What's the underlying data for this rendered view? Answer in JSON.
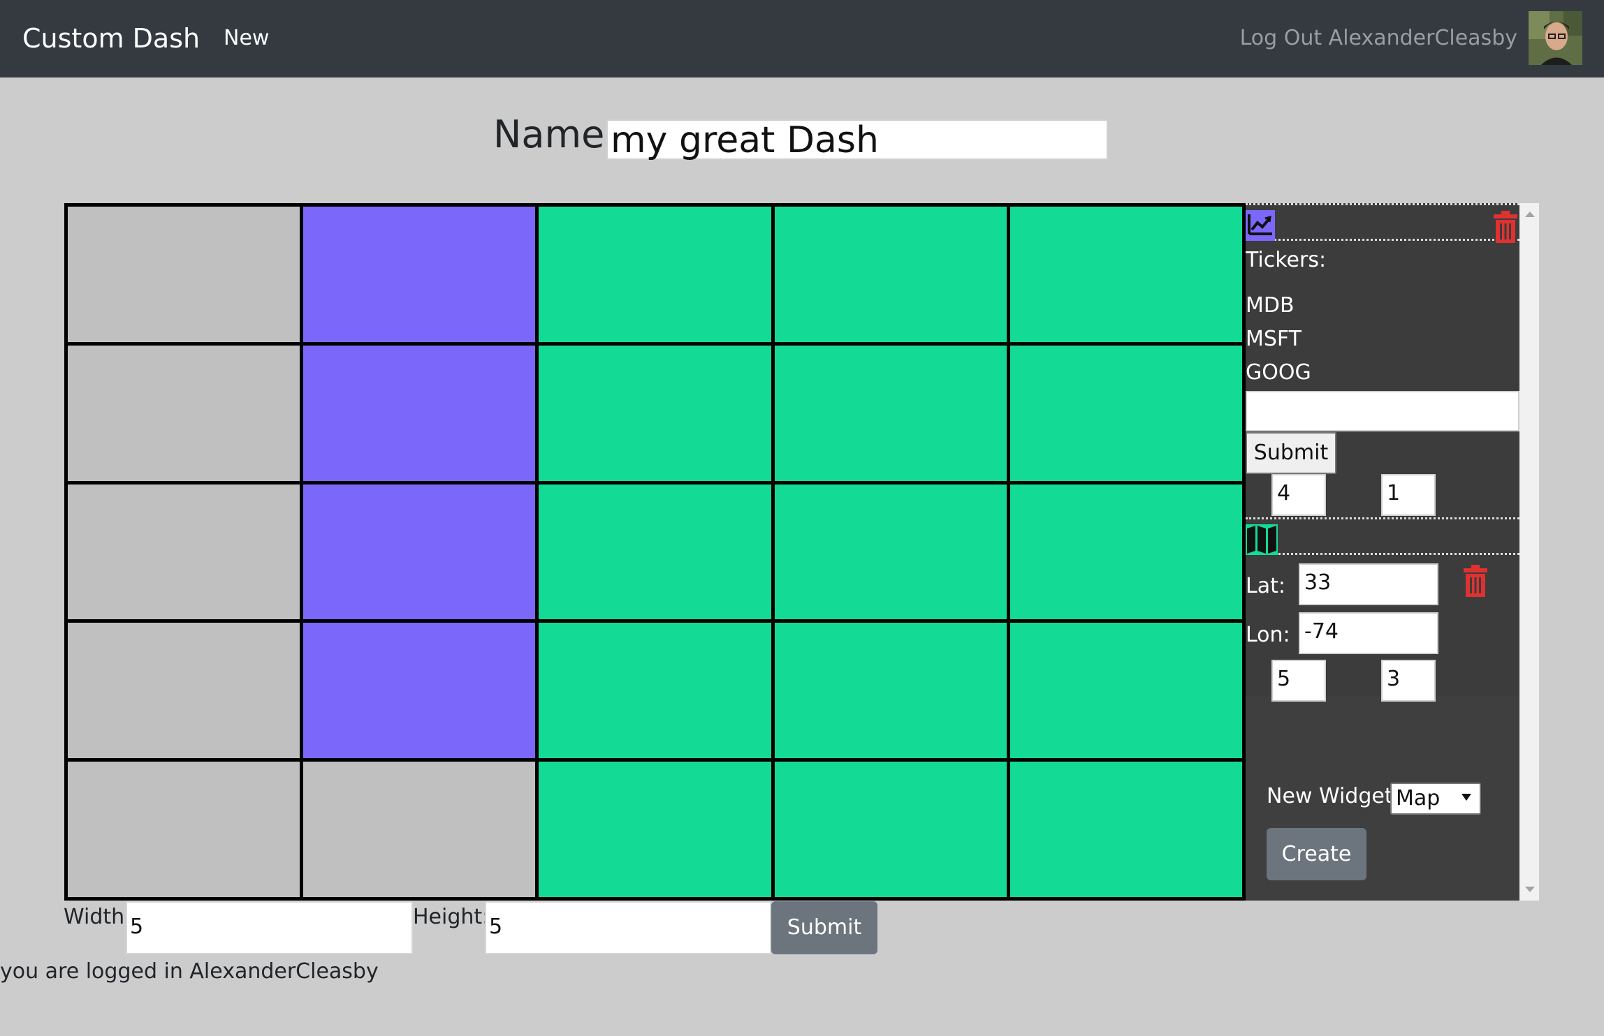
{
  "navbar": {
    "brand": "Custom Dash",
    "new_link": "New",
    "logout": "Log Out AlexanderCleasby"
  },
  "name_field": {
    "label": "Name:",
    "value": "my great Dash"
  },
  "grid": {
    "rows": 5,
    "cols": 5,
    "colors": {
      "empty": "#c0c0c0",
      "stock": "#7b68fa",
      "map": "#13db96",
      "border": "#000000"
    },
    "cells": [
      [
        "empty",
        "stock",
        "map",
        "map",
        "map"
      ],
      [
        "empty",
        "stock",
        "map",
        "map",
        "map"
      ],
      [
        "empty",
        "stock",
        "map",
        "map",
        "map"
      ],
      [
        "empty",
        "stock",
        "map",
        "map",
        "map"
      ],
      [
        "empty",
        "empty",
        "map",
        "map",
        "map"
      ]
    ]
  },
  "panel": {
    "stock_widget": {
      "icon": "chart-line-icon",
      "icon_color": "#7b68fa",
      "delete_icon": "trash-icon",
      "delete_color": "#e03131",
      "tickers_label": "Tickers:",
      "tickers": [
        "MDB",
        "MSFT",
        "GOOG"
      ],
      "ticker_input": "",
      "submit_label": "Submit",
      "width_value": "4",
      "height_value": "1"
    },
    "map_widget": {
      "icon": "map-icon",
      "icon_color": "#13db96",
      "delete_icon": "trash-icon",
      "lat_label": "Lat:",
      "lat_value": "33",
      "lon_label": "Lon:",
      "lon_value": "-74",
      "width_value": "5",
      "height_value": "3"
    },
    "new_widget": {
      "label": "New Widget:",
      "selected": "Map",
      "create_label": "Create"
    }
  },
  "grid_controls": {
    "width_label": "Width:",
    "width_value": "5",
    "height_label": "Height:",
    "height_value": "5",
    "submit_label": "Submit"
  },
  "footer": {
    "text": "you are logged in AlexanderCleasby"
  }
}
